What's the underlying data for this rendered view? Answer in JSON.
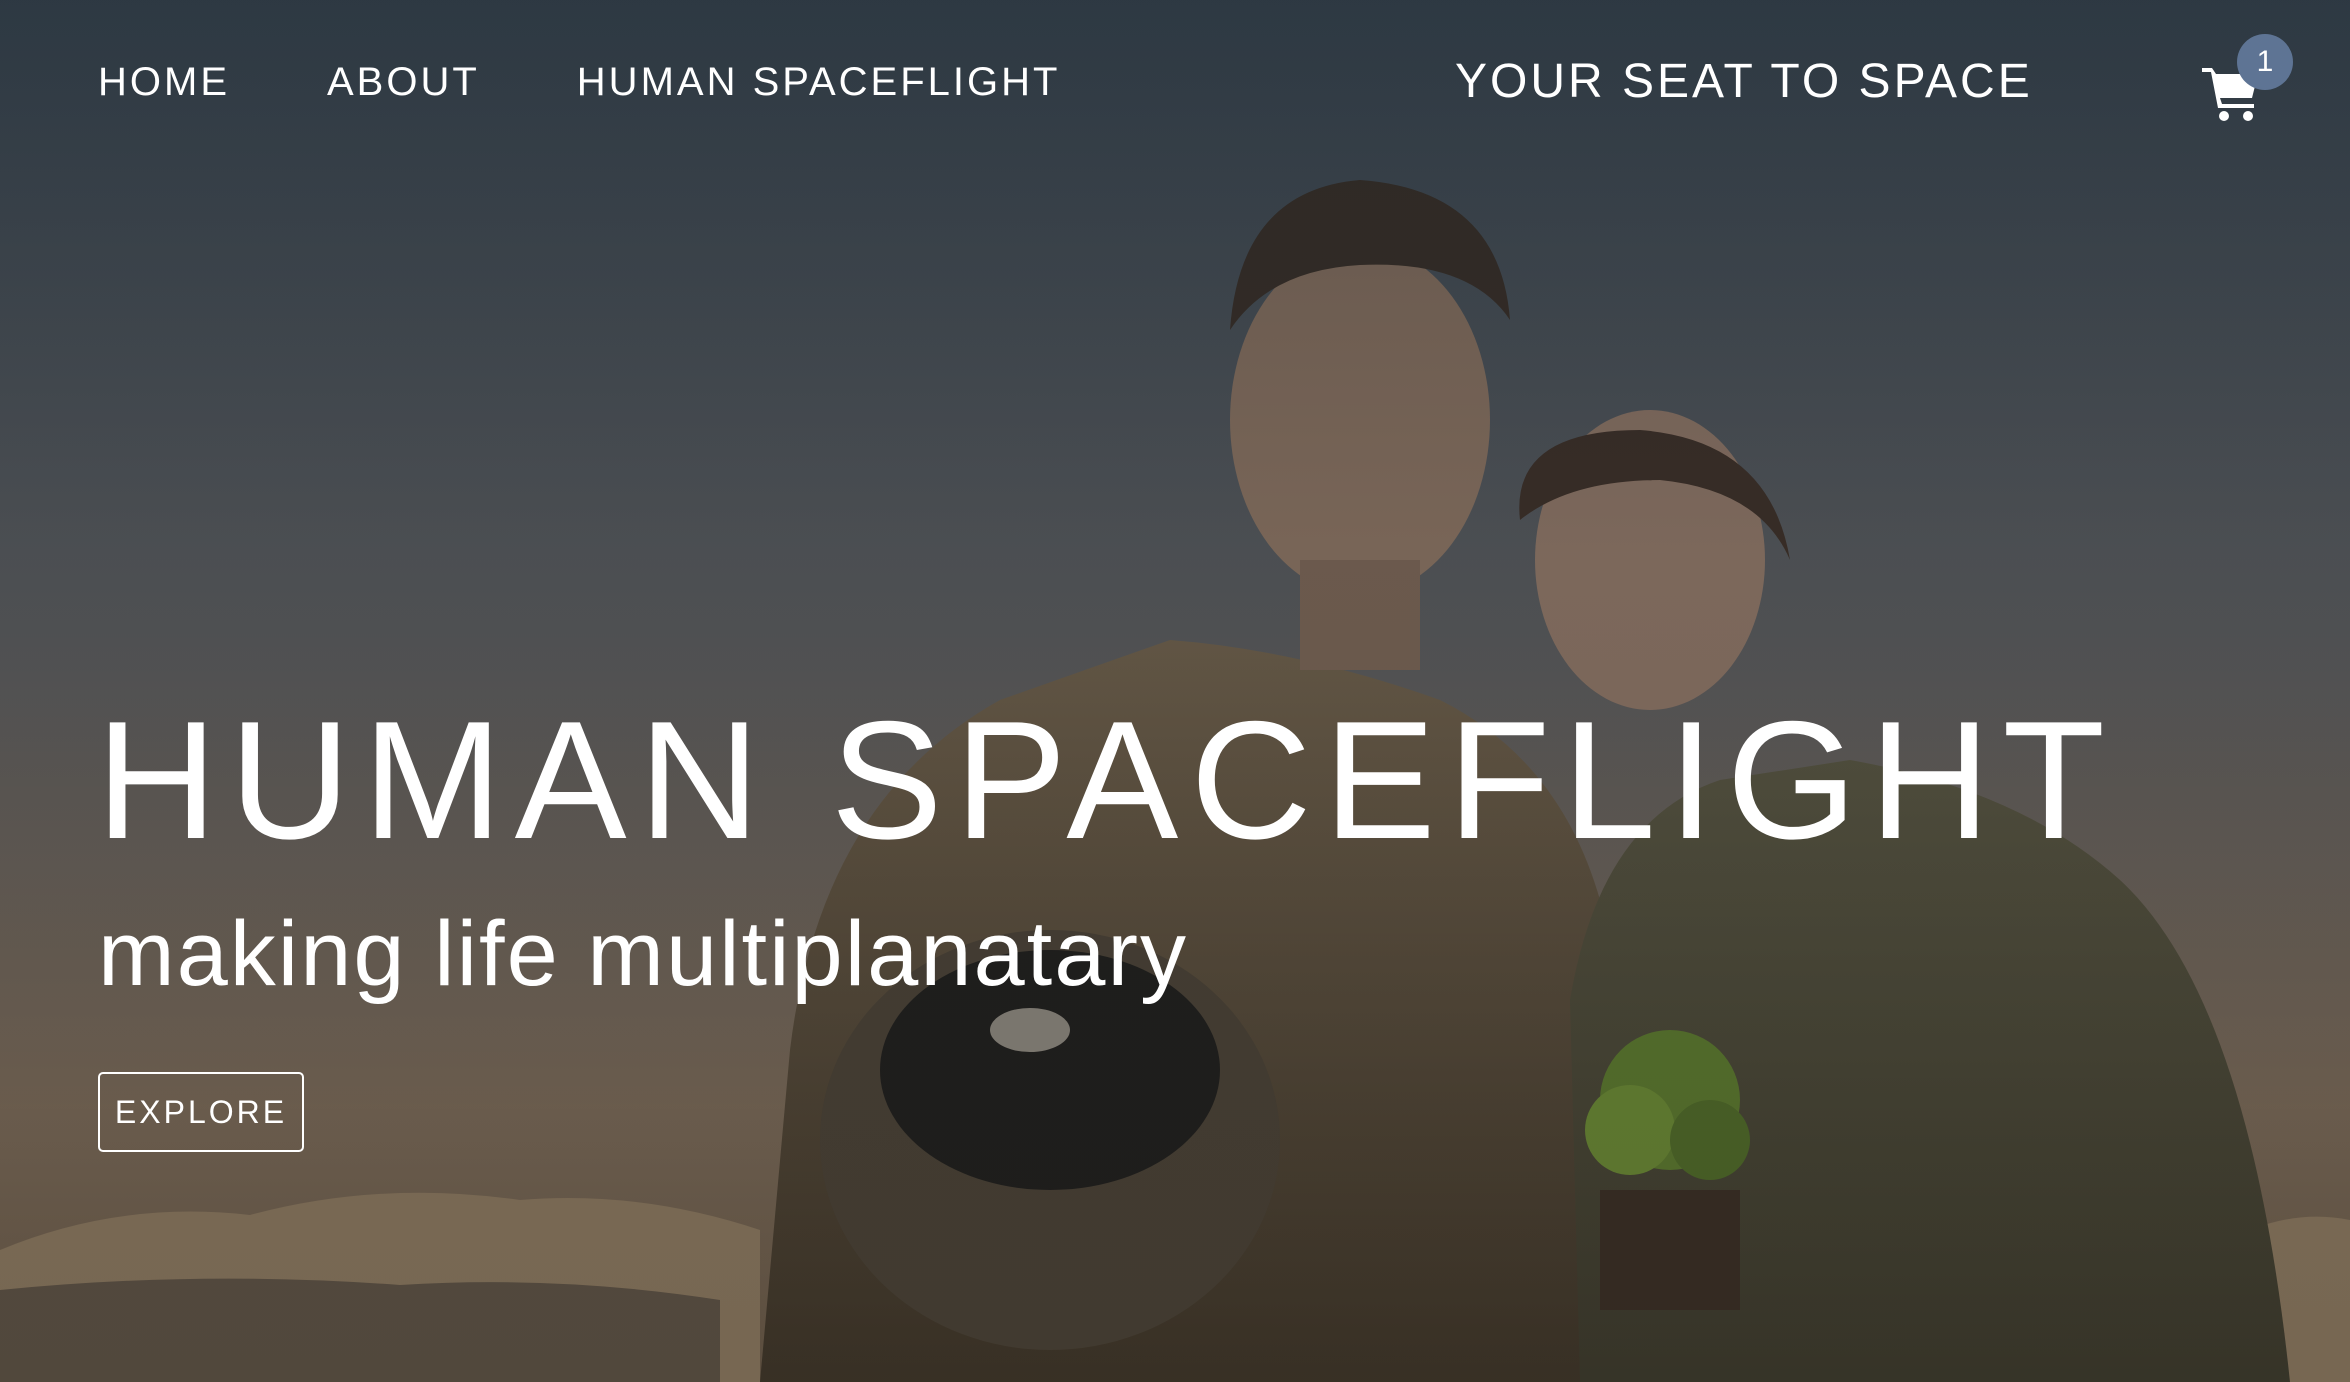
{
  "nav": {
    "links": [
      {
        "label": "HOME"
      },
      {
        "label": "ABOUT"
      },
      {
        "label": "HUMAN SPACEFLIGHT"
      }
    ],
    "brand": "YOUR SEAT TO SPACE"
  },
  "cart": {
    "icon": "shopping-cart-icon",
    "count": "1"
  },
  "hero": {
    "title": "HUMAN SPACEFLIGHT",
    "subtitle": "making life multiplanatary",
    "explore_label": "EXPLORE"
  },
  "colors": {
    "badge": "#5e7494",
    "text": "#ffffff"
  }
}
